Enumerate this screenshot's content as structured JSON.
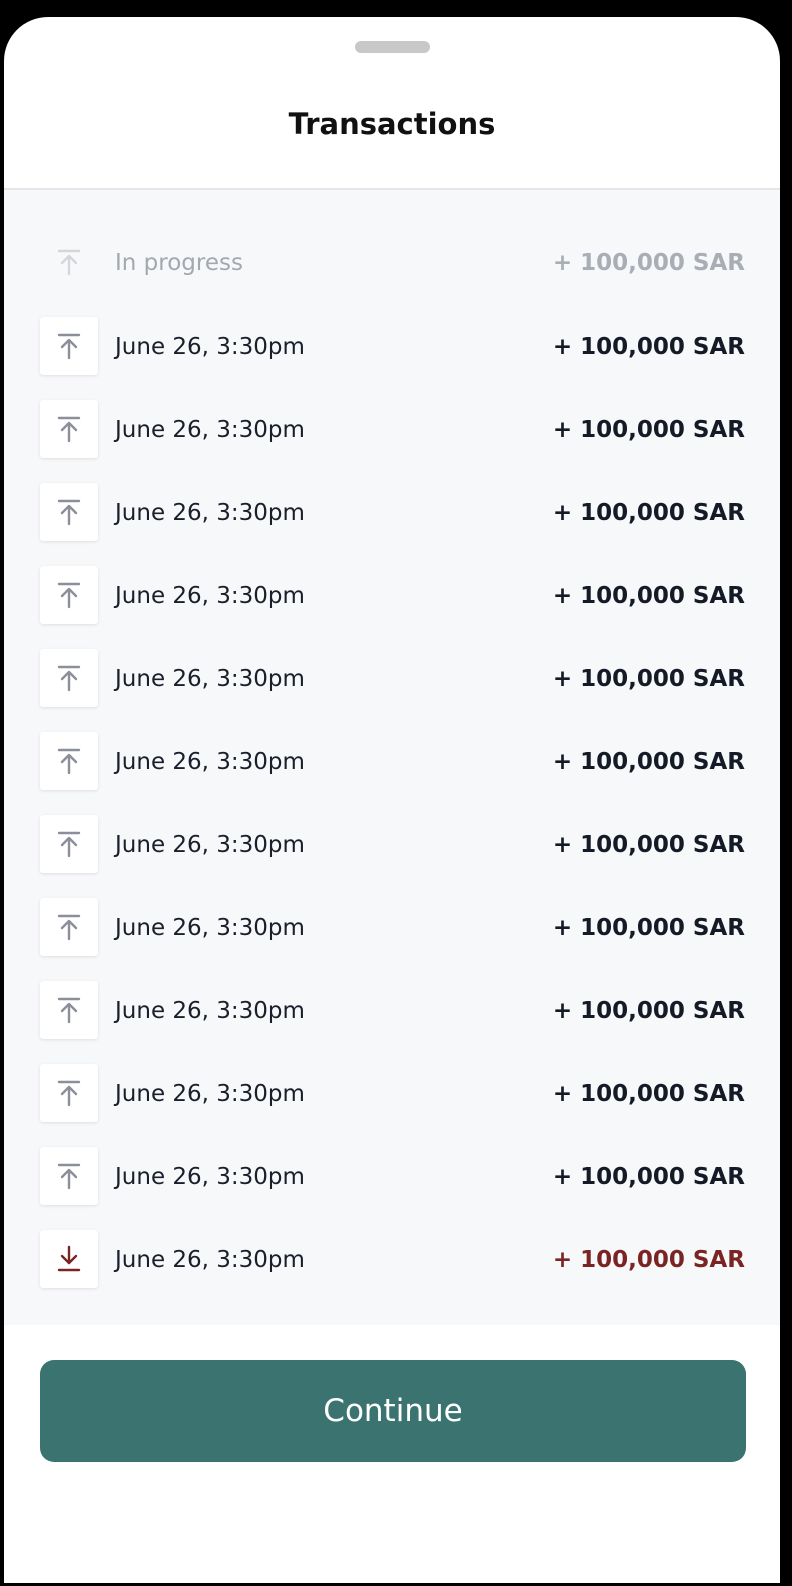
{
  "header": {
    "title": "Transactions"
  },
  "transactions": [
    {
      "label": "In progress",
      "amount": "+ 100,000 SAR",
      "state": "pending",
      "icon": "upload-icon"
    },
    {
      "label": "June 26, 3:30pm",
      "amount": "+ 100,000 SAR",
      "state": "credit",
      "icon": "upload-icon"
    },
    {
      "label": "June 26, 3:30pm",
      "amount": "+ 100,000 SAR",
      "state": "credit",
      "icon": "upload-icon"
    },
    {
      "label": "June 26, 3:30pm",
      "amount": "+ 100,000 SAR",
      "state": "credit",
      "icon": "upload-icon"
    },
    {
      "label": "June 26, 3:30pm",
      "amount": "+ 100,000 SAR",
      "state": "credit",
      "icon": "upload-icon"
    },
    {
      "label": "June 26, 3:30pm",
      "amount": "+ 100,000 SAR",
      "state": "credit",
      "icon": "upload-icon"
    },
    {
      "label": "June 26, 3:30pm",
      "amount": "+ 100,000 SAR",
      "state": "credit",
      "icon": "upload-icon"
    },
    {
      "label": "June 26, 3:30pm",
      "amount": "+ 100,000 SAR",
      "state": "credit",
      "icon": "upload-icon"
    },
    {
      "label": "June 26, 3:30pm",
      "amount": "+ 100,000 SAR",
      "state": "credit",
      "icon": "upload-icon"
    },
    {
      "label": "June 26, 3:30pm",
      "amount": "+ 100,000 SAR",
      "state": "credit",
      "icon": "upload-icon"
    },
    {
      "label": "June 26, 3:30pm",
      "amount": "+ 100,000 SAR",
      "state": "credit",
      "icon": "upload-icon"
    },
    {
      "label": "June 26, 3:30pm",
      "amount": "+ 100,000 SAR",
      "state": "credit",
      "icon": "upload-icon"
    },
    {
      "label": "June 26, 3:30pm",
      "amount": "+ 100,000 SAR",
      "state": "debit",
      "icon": "download-icon"
    }
  ],
  "footer": {
    "continue_label": "Continue"
  },
  "colors": {
    "accent": "#3a7370",
    "debit": "#7a2424",
    "pending": "#a9aeb6",
    "icon": "#8a8f99"
  }
}
